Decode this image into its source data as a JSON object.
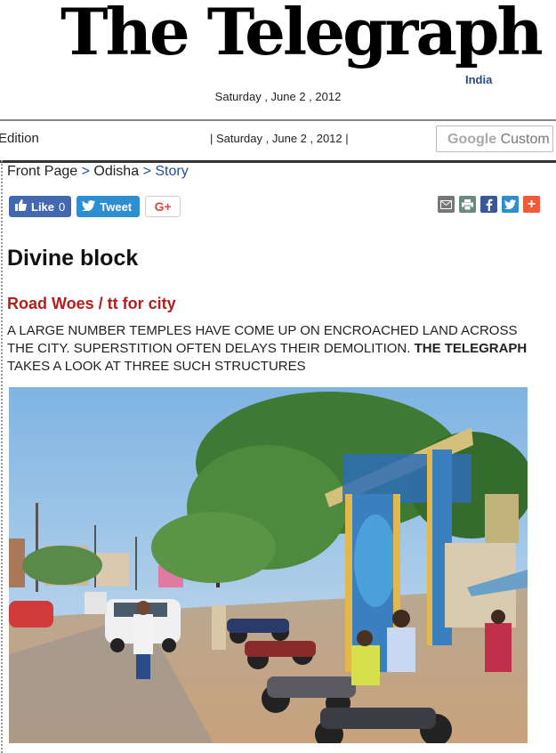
{
  "masthead": {
    "logo_text": "The Telegraph",
    "logo_sub": "India",
    "date": "Saturday , June 2 , 2012"
  },
  "topbar": {
    "edition": "Edition",
    "date": "| Saturday , June 2 , 2012 |",
    "search_brand": "Google",
    "search_label": "Custom"
  },
  "breadcrumb": {
    "items": [
      "Front Page",
      "Odisha",
      "Story"
    ],
    "separator": ">"
  },
  "share": {
    "like_label": "Like",
    "like_count": "0",
    "tweet_label": "Tweet",
    "gplus_label": "G+",
    "icons": [
      "email-icon",
      "print-icon",
      "facebook-icon",
      "twitter-icon",
      "add-icon"
    ]
  },
  "article": {
    "headline": "Divine block",
    "kicker": "Road Woes / tt for city",
    "deck_part1": "A LARGE NUMBER TEMPLES HAVE COME UP ON ENCROACHED LAND ACROSS THE CITY. SUPERSTITION OFTEN DELAYS THEIR DEMOLITION.",
    "deck_bold": "THE TELEGRAPH",
    "deck_part2": "TAKES A LOOK AT THREE SUCH STRUCTURES"
  },
  "colors": {
    "kicker": "#b31e1e",
    "link": "#23508f",
    "facebook": "#4468b0",
    "twitter": "#2d8fd2"
  }
}
